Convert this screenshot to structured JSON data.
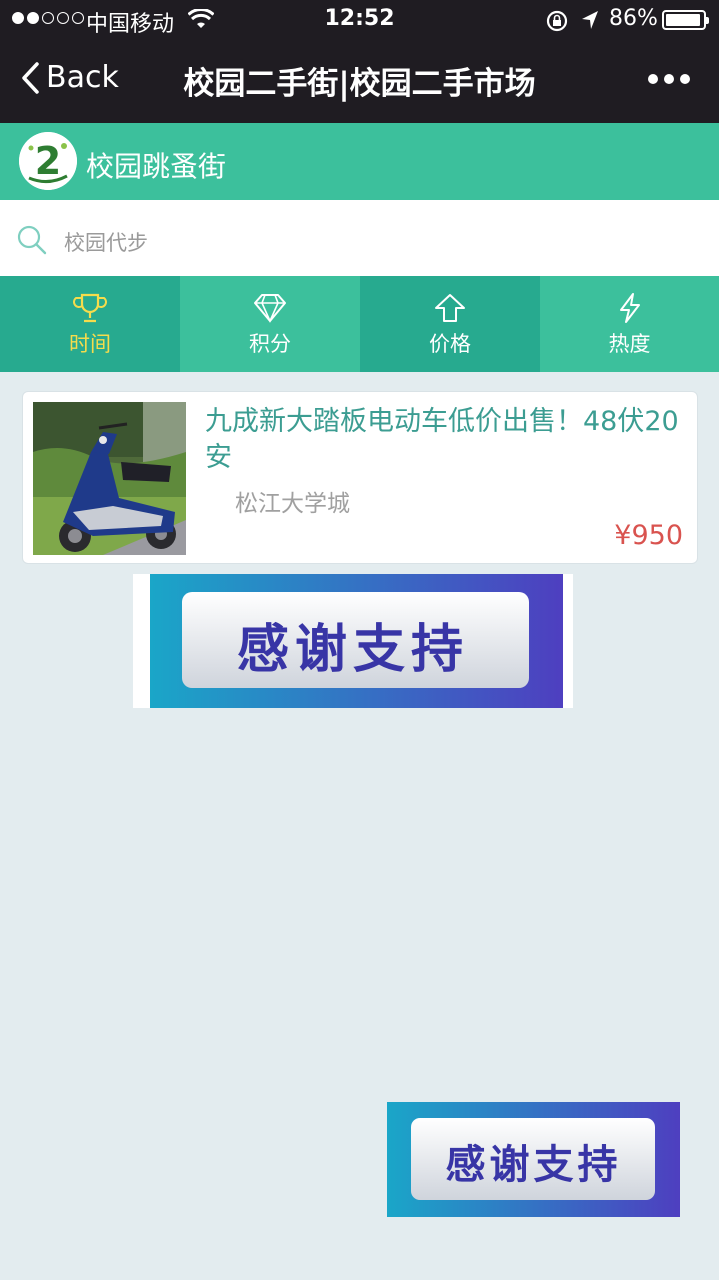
{
  "status": {
    "carrier": "中国移动",
    "time": "12:52",
    "battery": "86%",
    "battery_level": 0.86
  },
  "nav": {
    "back_label": "Back",
    "title": "校园二手街|校园二手市场"
  },
  "brand": {
    "name": "校园跳蚤街",
    "logo_text": "2"
  },
  "search": {
    "placeholder": "校园代步"
  },
  "tabs": [
    {
      "label": "时间",
      "icon": "trophy-icon",
      "active": true
    },
    {
      "label": "积分",
      "icon": "diamond-icon",
      "active": false
    },
    {
      "label": "价格",
      "icon": "up-arrow-icon",
      "active": false
    },
    {
      "label": "热度",
      "icon": "lightning-icon",
      "active": false
    }
  ],
  "listing": {
    "title": "九成新大踏板电动车低价出售！48伏20安",
    "location": "松江大学城",
    "price": "¥950",
    "image": "scooter-photo"
  },
  "banners": {
    "thanks_text": "感谢支持"
  },
  "colors": {
    "nav_bg": "#1f1c22",
    "brand_green": "#3cc09c",
    "tab_dark": "#27aa8f",
    "tab_light": "#3cc09c",
    "active_tab": "#f5dc4c",
    "title_teal": "#3c9d92",
    "price_red": "#d9534f",
    "page_bg": "#e3ecef"
  }
}
